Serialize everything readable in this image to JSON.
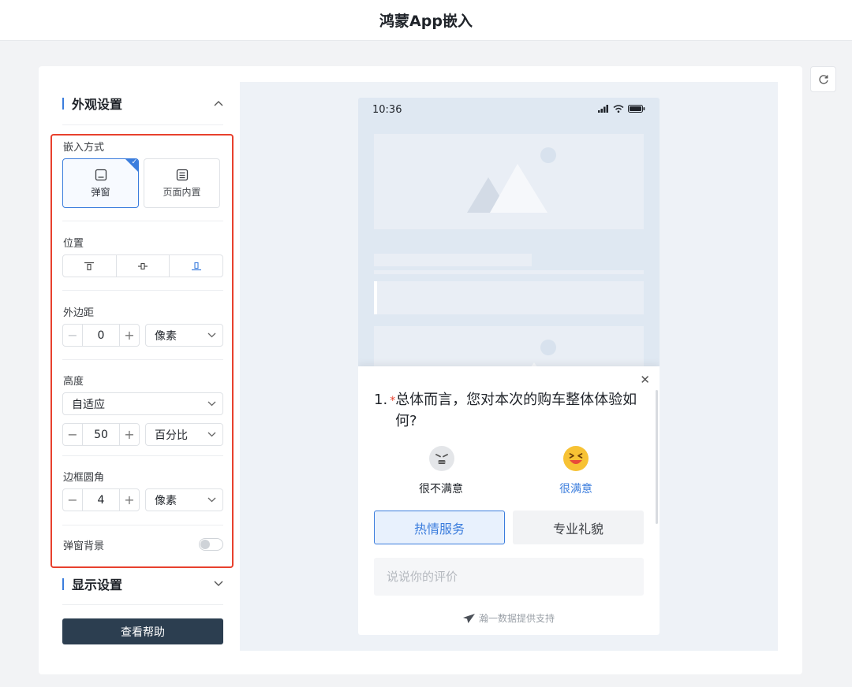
{
  "page_title": "鸿蒙App嵌入",
  "left": {
    "appearance_title": "外观设置",
    "embed_mode_label": "嵌入方式",
    "embed_options": [
      {
        "label": "弹窗",
        "selected": true
      },
      {
        "label": "页面内置",
        "selected": false
      }
    ],
    "position_label": "位置",
    "position_options": [
      "top",
      "middle",
      "bottom"
    ],
    "position_selected": "bottom",
    "margin_label": "外边距",
    "margin_value": "0",
    "margin_unit": "像素",
    "height_label": "高度",
    "height_mode": "自适应",
    "height_value": "50",
    "height_unit": "百分比",
    "radius_label": "边框圆角",
    "radius_value": "4",
    "radius_unit": "像素",
    "popup_bg_label": "弹窗背景",
    "popup_bg_on": false,
    "display_title": "显示设置",
    "help_button": "查看帮助"
  },
  "preview": {
    "time": "10:36",
    "question_number": "1.",
    "required_mark": "*",
    "question_line1": "总体而言，您对本次的购车整体体验如",
    "question_line2": "何?",
    "option_unsatisfied": "很不满意",
    "option_satisfied": "很满意",
    "tag_selected": "热情服务",
    "tag_other": "专业礼貌",
    "comment_placeholder": "说说你的评价",
    "powered_by": "瀚一数据提供支持"
  },
  "colors": {
    "accent": "#3b7ddd",
    "highlight_box": "#e8402d",
    "help_button_bg": "#2c3e50",
    "preview_bg": "#eef2f7",
    "phone_bg": "#dfe8f2"
  }
}
